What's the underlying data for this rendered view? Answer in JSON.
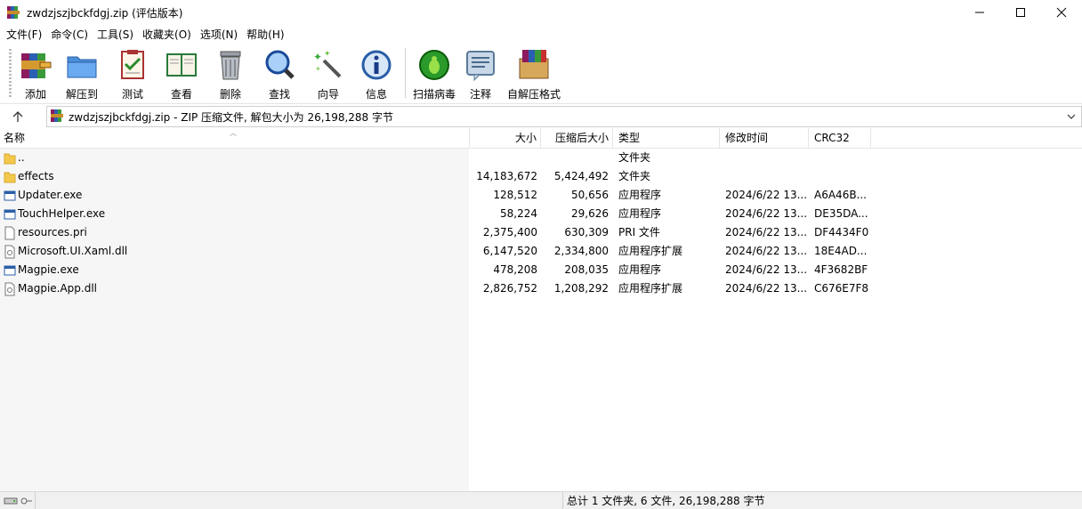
{
  "window": {
    "title": "zwdzjszjbckfdgj.zip (评估版本)",
    "controls": [
      "minimize-icon",
      "maximize-icon",
      "close-icon"
    ]
  },
  "menu": {
    "items": [
      {
        "label": "文件(F)"
      },
      {
        "label": "命令(C)"
      },
      {
        "label": "工具(S)"
      },
      {
        "label": "收藏夹(O)"
      },
      {
        "label": "选项(N)"
      },
      {
        "label": "帮助(H)"
      }
    ]
  },
  "toolbar": {
    "buttons": [
      {
        "label": "添加",
        "icon": "add-archive-icon"
      },
      {
        "label": "解压到",
        "icon": "extract-to-icon"
      },
      {
        "label": "测试",
        "icon": "test-icon"
      },
      {
        "label": "查看",
        "icon": "view-icon"
      },
      {
        "label": "删除",
        "icon": "delete-icon"
      },
      {
        "label": "查找",
        "icon": "find-icon"
      },
      {
        "label": "向导",
        "icon": "wizard-icon"
      },
      {
        "label": "信息",
        "icon": "info-icon"
      },
      {
        "label": "扫描病毒",
        "icon": "virus-scan-icon"
      },
      {
        "label": "注释",
        "icon": "comment-icon"
      },
      {
        "label": "自解压格式",
        "icon": "sfx-icon"
      }
    ]
  },
  "address": {
    "text": "zwdzjszjbckfdgj.zip - ZIP 压缩文件, 解包大小为 26,198,288 字节"
  },
  "columns": {
    "name": "名称",
    "size": "大小",
    "packed": "压缩后大小",
    "type": "类型",
    "modified": "修改时间",
    "crc": "CRC32"
  },
  "files": [
    {
      "name": "..",
      "size": "",
      "packed": "",
      "type": "文件夹",
      "modified": "",
      "crc": "",
      "icon": "folder-icon"
    },
    {
      "name": "effects",
      "size": "14,183,672",
      "packed": "5,424,492",
      "type": "文件夹",
      "modified": "",
      "crc": "",
      "icon": "folder-icon"
    },
    {
      "name": "Updater.exe",
      "size": "128,512",
      "packed": "50,656",
      "type": "应用程序",
      "modified": "2024/6/22 13...",
      "crc": "A6A46B...",
      "icon": "exe-icon"
    },
    {
      "name": "TouchHelper.exe",
      "size": "58,224",
      "packed": "29,626",
      "type": "应用程序",
      "modified": "2024/6/22 13...",
      "crc": "DE35DA...",
      "icon": "exe-icon"
    },
    {
      "name": "resources.pri",
      "size": "2,375,400",
      "packed": "630,309",
      "type": "PRI 文件",
      "modified": "2024/6/22 13...",
      "crc": "DF4434F0",
      "icon": "file-icon"
    },
    {
      "name": "Microsoft.UI.Xaml.dll",
      "size": "6,147,520",
      "packed": "2,334,800",
      "type": "应用程序扩展",
      "modified": "2024/6/22 13...",
      "crc": "18E4AD...",
      "icon": "dll-icon"
    },
    {
      "name": "Magpie.exe",
      "size": "478,208",
      "packed": "208,035",
      "type": "应用程序",
      "modified": "2024/6/22 13...",
      "crc": "4F3682BF",
      "icon": "exe-icon"
    },
    {
      "name": "Magpie.App.dll",
      "size": "2,826,752",
      "packed": "1,208,292",
      "type": "应用程序扩展",
      "modified": "2024/6/22 13...",
      "crc": "C676E7F8",
      "icon": "dll-icon"
    }
  ],
  "status": {
    "summary": "总计 1 文件夹, 6 文件, 26,198,288 字节"
  }
}
